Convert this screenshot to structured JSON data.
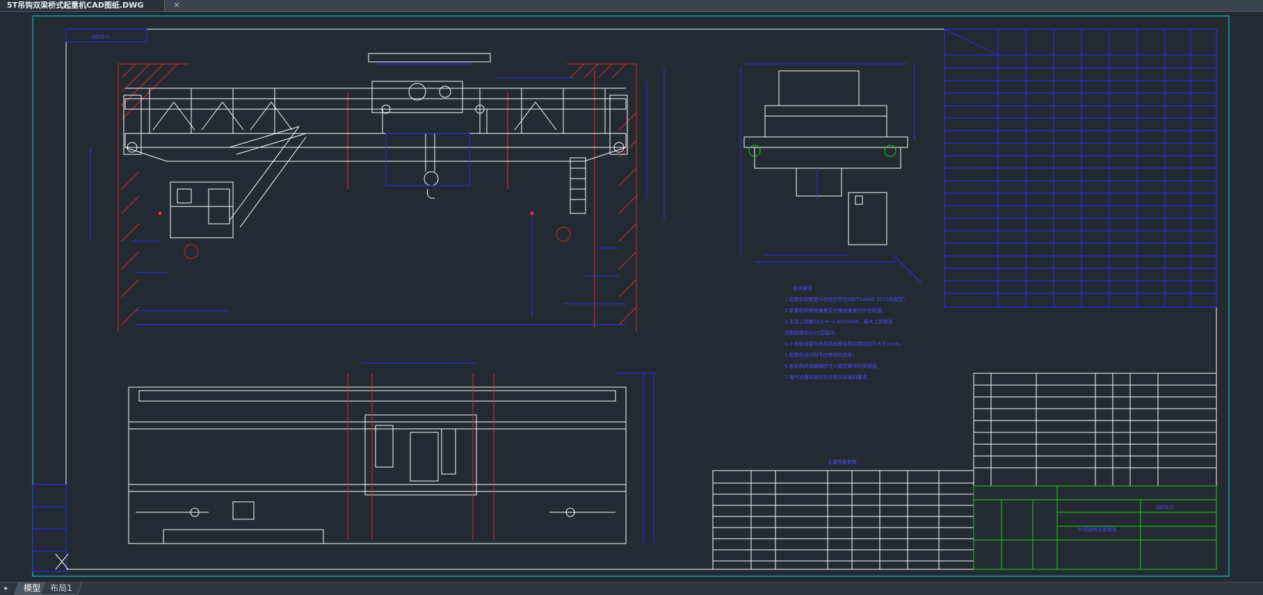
{
  "window": {
    "document_tab": "5T吊钩双梁桥式起重机CAD图纸.DWG",
    "close_glyph": "✕"
  },
  "layout_tabs": [
    {
      "label": "模型",
      "active": true
    },
    {
      "label": "布局1",
      "active": false
    }
  ],
  "nav_glyph": "▸",
  "drawing": {
    "title_box_label": "QD5t-S",
    "drawing_number": "5t双梁桥式起重机",
    "notes_title": "技术要求",
    "parameter_title": "主要性能参数",
    "technical_notes": [
      "1.起重机的制造与验收应符合GB/T14405-2011的规定。",
      "2.起重机的跨度偏差及对角线偏差应符合标准。",
      "3.主梁上拱度为(0.9~1.4)S/1000，最大上拱度应",
      "  控制在跨中S/10范围内。",
      "4.小车轨道接头处的高低差及侧向错位应不大于1mm。",
      "5.起重机运行时不应有啃轨现象。",
      "6.各机构的减速器应注入规定牌号的润滑油。",
      "7.电气设备安装应符合有关标准的要求。"
    ],
    "colors": {
      "background": "#232a31",
      "frame": "#ffffff",
      "dimension": "#2a2cff",
      "center_line": "#ff2a2a",
      "hatch": "#d92a2a",
      "viewport": "#00c8d8",
      "title_grid": "#19d119"
    }
  }
}
